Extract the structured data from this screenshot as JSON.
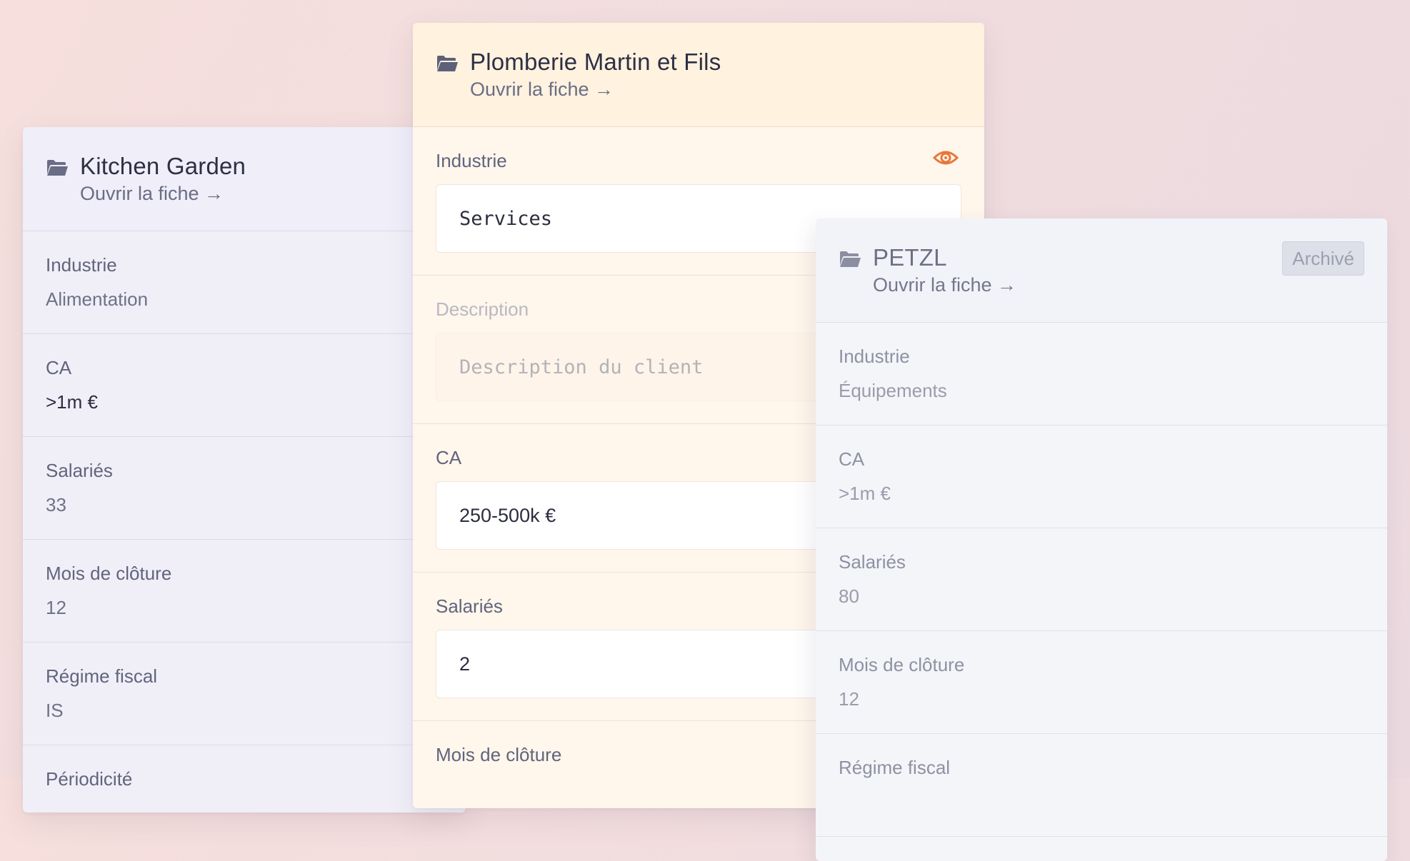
{
  "theme": {
    "accent": "#e8773a",
    "left_card_bg": "#f0eff8",
    "middle_card_bg": "#fff6ec",
    "right_card_bg": "#f4f5f9"
  },
  "cards": {
    "left": {
      "title": "Kitchen Garden",
      "link": "Ouvrir la fiche →",
      "icon": "folder-open-icon",
      "fields": [
        {
          "label": "Industrie",
          "value": "Alimentation"
        },
        {
          "label": "CA",
          "value": ">1m €"
        },
        {
          "label": "Salariés",
          "value": "33"
        },
        {
          "label": "Mois de clôture",
          "value": "12"
        },
        {
          "label": "Régime fiscal",
          "value": "IS"
        },
        {
          "label": "Périodicité",
          "value": ""
        }
      ]
    },
    "middle": {
      "title": "Plomberie Martin et Fils",
      "link": "Ouvrir la fiche →",
      "icon": "folder-open-icon",
      "visibility_icon": "eye-icon",
      "fields": [
        {
          "label": "Industrie",
          "value": "Services"
        },
        {
          "label": "Description",
          "placeholder": "Description du client",
          "value": ""
        },
        {
          "label": "CA",
          "value": "250-500k €"
        },
        {
          "label": "Salariés",
          "value": "2"
        },
        {
          "label": "Mois de clôture",
          "value": ""
        }
      ]
    },
    "right": {
      "title": "PETZL",
      "link": "Ouvrir la fiche →",
      "badge": "Archivé",
      "icon": "folder-open-icon",
      "fields": [
        {
          "label": "Industrie",
          "value": "Équipements"
        },
        {
          "label": "CA",
          "value": ">1m €"
        },
        {
          "label": "Salariés",
          "value": "80"
        },
        {
          "label": "Mois de clôture",
          "value": "12"
        },
        {
          "label": "Régime fiscal",
          "value": ""
        }
      ]
    }
  }
}
